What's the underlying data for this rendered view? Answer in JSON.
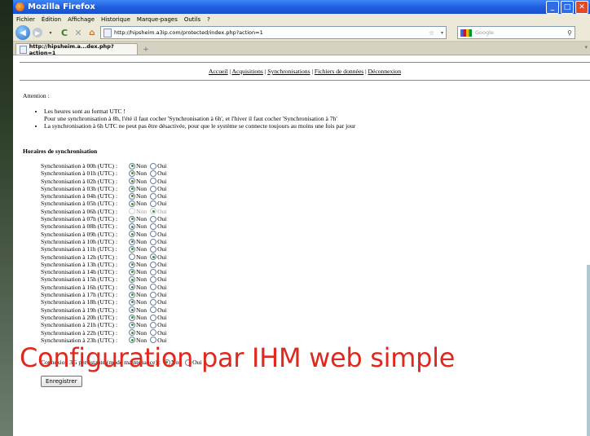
{
  "window": {
    "title": "Mozilla Firefox"
  },
  "menu": [
    "Fichier",
    "Édition",
    "Affichage",
    "Historique",
    "Marque-pages",
    "Outils",
    "?"
  ],
  "address": {
    "url": "http://hipsheim.a3ip.com/protected/index.php?action=1"
  },
  "search": {
    "placeholder": "Google"
  },
  "tab": {
    "title": "http://hipsheim.a...dex.php?action=1"
  },
  "nav_links": [
    "Accueil",
    "Acquisitions",
    "Synchronisations",
    "Fichiers de données",
    "Déconnexion"
  ],
  "attention": {
    "title": "Attention :",
    "bullets": [
      "Les heures sont au format UTC !",
      "Pour une synchronisation à 8h, l'été il faut cocher 'Synchronisation à 6h', et l'hiver il faut cocher 'Synchronisation à 7h'",
      "La synchronisation à 6h UTC ne peut pas être désactivée, pour que le système se connecte toujours au moins une fois par jour"
    ]
  },
  "schedule": {
    "title": "Horaires de synchronisation",
    "non_label": "Non",
    "oui_label": "Oui",
    "rows": [
      {
        "label": "Synchronisation à 00h (UTC) :",
        "value": "Non"
      },
      {
        "label": "Synchronisation à 01h (UTC) :",
        "value": "Non"
      },
      {
        "label": "Synchronisation à 02h (UTC) :",
        "value": "Non"
      },
      {
        "label": "Synchronisation à 03h (UTC) :",
        "value": "Non"
      },
      {
        "label": "Synchronisation à 04h (UTC) :",
        "value": "Non"
      },
      {
        "label": "Synchronisation à 05h (UTC) :",
        "value": "Non"
      },
      {
        "label": "Synchronisation à 06h (UTC) :",
        "value": "Oui",
        "disabled": true
      },
      {
        "label": "Synchronisation à 07h (UTC) :",
        "value": "Non"
      },
      {
        "label": "Synchronisation à 08h (UTC) :",
        "value": "Non"
      },
      {
        "label": "Synchronisation à 09h (UTC) :",
        "value": "Non"
      },
      {
        "label": "Synchronisation à 10h (UTC) :",
        "value": "Non"
      },
      {
        "label": "Synchronisation à 11h (UTC) :",
        "value": "Non"
      },
      {
        "label": "Synchronisation à 12h (UTC) :",
        "value": "Oui"
      },
      {
        "label": "Synchronisation à 13h (UTC) :",
        "value": "Non"
      },
      {
        "label": "Synchronisation à 14h (UTC) :",
        "value": "Non"
      },
      {
        "label": "Synchronisation à 15h (UTC) :",
        "value": "Non"
      },
      {
        "label": "Synchronisation à 16h (UTC) :",
        "value": "Non"
      },
      {
        "label": "Synchronisation à 17h (UTC) :",
        "value": "Non"
      },
      {
        "label": "Synchronisation à 18h (UTC) :",
        "value": "Non"
      },
      {
        "label": "Synchronisation à 19h (UTC) :",
        "value": "Non"
      },
      {
        "label": "Synchronisation à 20h (UTC) :",
        "value": "Non"
      },
      {
        "label": "Synchronisation à 21h (UTC) :",
        "value": "Non"
      },
      {
        "label": "Synchronisation à 22h (UTC) :",
        "value": "Non"
      },
      {
        "label": "Synchronisation à 23h (UTC) :",
        "value": "Non"
      }
    ]
  },
  "persistent": {
    "label": "Connexion 3G persistante (mode maintenance) :",
    "value": "Non"
  },
  "save_label": "Enregistrer",
  "overlay_caption": "Configuration par IHM web simple",
  "colors": {
    "titlebar": "#1f5fe0",
    "overlay": "#e0281e",
    "radio_checked": "#2f9c2f"
  }
}
